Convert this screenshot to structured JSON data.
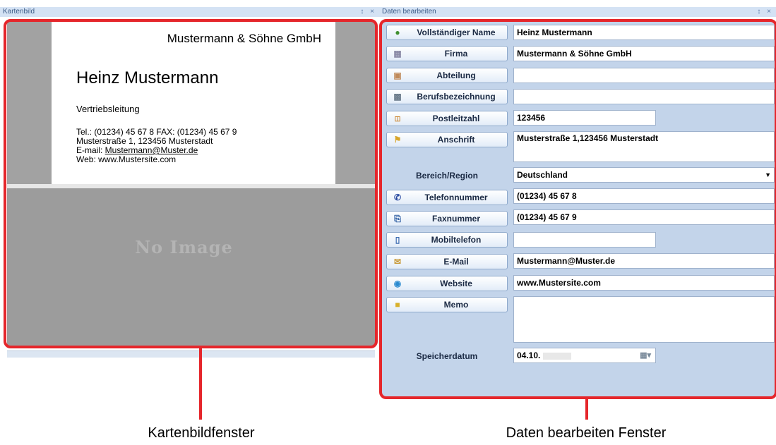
{
  "left_panel": {
    "title": "Kartenbild",
    "controls": "↕ ×",
    "card": {
      "company": "Mustermann & Söhne GmbH",
      "name": "Heinz Mustermann",
      "role": "Vertriebsleitung",
      "tel_fax": "Tel.: (01234) 45 67 8 FAX: (01234) 45 67 9",
      "address": "Musterstraße 1, 123456 Musterstadt",
      "email_prefix": "E-mail: ",
      "email": "Mustermann@Muster.de",
      "web": "Web: www.Mustersite.com"
    },
    "no_image": "No Image"
  },
  "right_panel": {
    "title": "Daten bearbeiten",
    "controls": "↕ ×",
    "fields": {
      "full_name": {
        "label": "Vollständiger Name",
        "value": "Heinz Mustermann",
        "icon": "person-icon"
      },
      "company": {
        "label": "Firma",
        "value": "Mustermann & Söhne GmbH",
        "icon": "building-icon"
      },
      "department": {
        "label": "Abteilung",
        "value": "",
        "icon": "department-icon"
      },
      "job_title": {
        "label": "Berufsbezeichnung",
        "value": "",
        "icon": "job-icon"
      },
      "postal_code": {
        "label": "Postleitzahl",
        "value": "123456",
        "icon": "postal-icon"
      },
      "address": {
        "label": "Anschrift",
        "value": "Musterstraße 1,123456 Musterstadt",
        "icon": "address-icon"
      },
      "region": {
        "label": "Bereich/Region",
        "value": "Deutschland"
      },
      "phone": {
        "label": "Telefonnummer",
        "value": "(01234) 45 67 8",
        "icon": "phone-icon"
      },
      "fax": {
        "label": "Faxnummer",
        "value": "(01234) 45 67 9",
        "icon": "fax-icon"
      },
      "mobile": {
        "label": "Mobiltelefon",
        "value": "",
        "icon": "mobile-icon"
      },
      "email": {
        "label": "E-Mail",
        "value": "Mustermann@Muster.de",
        "icon": "email-icon"
      },
      "website": {
        "label": "Website",
        "value": "www.Mustersite.com",
        "icon": "website-icon"
      },
      "memo": {
        "label": "Memo",
        "value": "",
        "icon": "memo-icon"
      },
      "save_date": {
        "label": "Speicherdatum",
        "value": "04.10."
      }
    }
  },
  "captions": {
    "left": "Kartenbildfenster",
    "right": "Daten bearbeiten Fenster"
  },
  "colors": {
    "highlight": "#e5262b",
    "panel_bg": "#c3d4ea",
    "title_bar": "#d4e2f4"
  }
}
